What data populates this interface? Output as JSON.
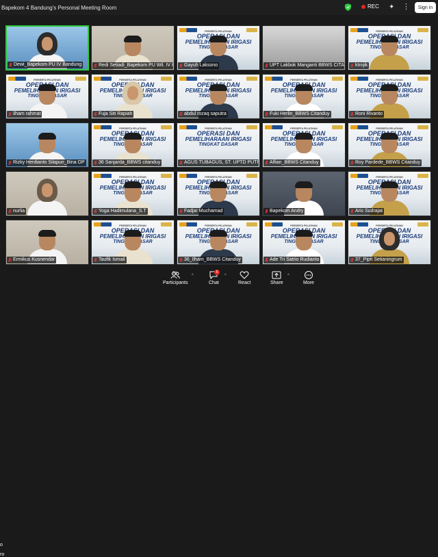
{
  "window": {
    "title": "Bapekom 4 Bandung's Personal Meeting Room",
    "rec_label": "REC",
    "sign_in_label": "Sign in",
    "security_color": "#2ecc40"
  },
  "slide": {
    "subtitle": "PERSERTA PELATIHAN",
    "line1": "OPERASI DAN",
    "line2": "PEMELIHARAAN IRIGASI",
    "line3": "TINGKAT DASAR"
  },
  "participants": [
    {
      "name": "Dewi_Bapekom PU IV Bandung",
      "bg": "blue",
      "kind": "hijab",
      "active": true
    },
    {
      "name": "Redi Setiadi_Bapekom PU Wil. IV Ban...",
      "bg": "room",
      "kind": "man",
      "active": false
    },
    {
      "name": "Gayuh Laksono",
      "bg": "slide",
      "kind": "man",
      "active": false
    },
    {
      "name": "UPT Lakbok Manganti BBWS CITAND...",
      "bg": "class",
      "kind": "none",
      "active": false
    },
    {
      "name": "ktrojik",
      "bg": "slide",
      "kind": "man",
      "active": false
    },
    {
      "name": "ilham rahmat",
      "bg": "slide",
      "kind": "man",
      "active": false
    },
    {
      "name": "Fuja Siti Rapiah",
      "bg": "slide",
      "kind": "hijab",
      "active": false
    },
    {
      "name": "abdul rozaq saputra",
      "bg": "slide",
      "kind": "man",
      "active": false
    },
    {
      "name": "Fuki Herlin_BBWS Citanduy",
      "bg": "slide",
      "kind": "man",
      "active": false
    },
    {
      "name": "Roni Rivanto",
      "bg": "slide",
      "kind": "man",
      "active": false
    },
    {
      "name": "Rizky Herdianto Silapun_Bina OP",
      "bg": "blue",
      "kind": "man",
      "active": false
    },
    {
      "name": "36 Sanjarda_BBWS citanduy",
      "bg": "slide",
      "kind": "man",
      "active": false
    },
    {
      "name": "AGUS TUBAGUS, ST. UPTD PUTRP BA...",
      "bg": "slide",
      "kind": "none",
      "active": false
    },
    {
      "name": "Alfian_BBWS Citanduy",
      "bg": "slide",
      "kind": "man",
      "active": false
    },
    {
      "name": "Roy Pardede_BBWS Citanduy",
      "bg": "slide",
      "kind": "man",
      "active": false
    },
    {
      "name": "nurlia",
      "bg": "room",
      "kind": "hijab",
      "active": false
    },
    {
      "name": "Yoga Hadimulana_S.T",
      "bg": "slide",
      "kind": "man",
      "active": false
    },
    {
      "name": "Fadjar Muchamad",
      "bg": "slide",
      "kind": "man",
      "active": false
    },
    {
      "name": "Bapekom Andry",
      "bg": "dark",
      "kind": "man",
      "active": false
    },
    {
      "name": "Aris Sudrajat",
      "bg": "slide",
      "kind": "man",
      "active": false
    },
    {
      "name": "Ermikus Kusnendar",
      "bg": "room",
      "kind": "man",
      "active": false
    },
    {
      "name": "Taufik Ismail",
      "bg": "slide",
      "kind": "man",
      "active": false
    },
    {
      "name": "36_Ilham_BBWS Citanduy",
      "bg": "slide",
      "kind": "man",
      "active": false
    },
    {
      "name": "Ade Tri Satrio Rudianto",
      "bg": "slide",
      "kind": "man",
      "active": false
    },
    {
      "name": "37_Pipit Setianingrum",
      "bg": "slide",
      "kind": "hijab",
      "active": false
    }
  ],
  "toolbar": {
    "participants_label": "Participants",
    "participants_count": "50",
    "chat_label": "Chat",
    "chat_badge": "5",
    "react_label": "React",
    "share_label": "Share",
    "more_label": "More",
    "left_cut_top": "o",
    "left_cut_bottom": "ro"
  }
}
